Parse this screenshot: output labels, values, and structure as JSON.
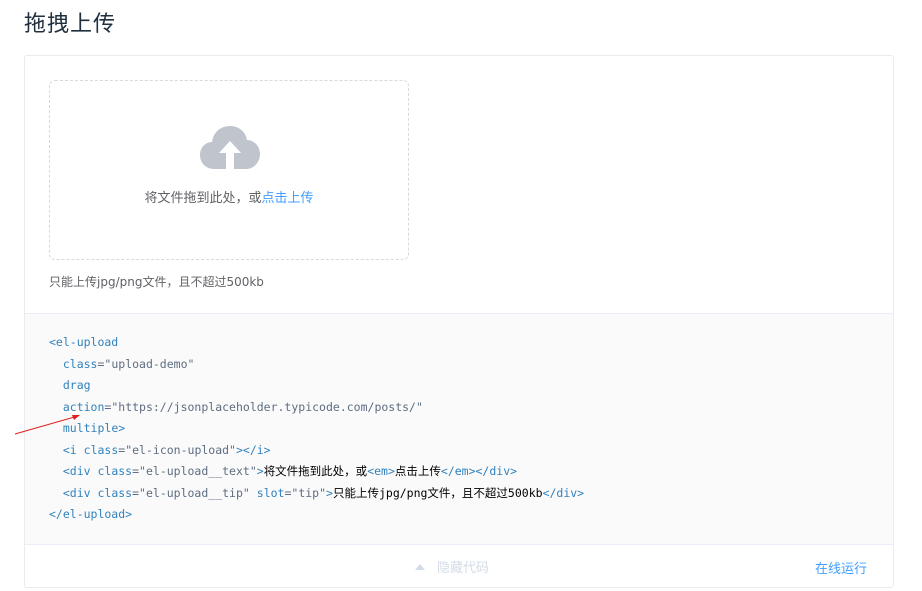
{
  "page": {
    "title": "拖拽上传"
  },
  "upload": {
    "drag_text": "将文件拖到此处，或",
    "click_text": "点击上传",
    "tip": "只能上传jpg/png文件，且不超过500kb"
  },
  "code": {
    "l1_open": "<el-upload",
    "l2_attr": "class",
    "l2_val": "\"upload-demo\"",
    "l3": "drag",
    "l4_attr": "action",
    "l4_val": "\"https://jsonplaceholder.typicode.com/posts/\"",
    "l5": "multiple>",
    "l6_open": "<i ",
    "l6_attr": "class",
    "l6_val": "\"el-icon-upload\"",
    "l6_close": "></i>",
    "l7_open": "<div ",
    "l7_attr": "class",
    "l7_val": "\"el-upload__text\"",
    "l7_gt": ">",
    "l7_text": "将文件拖到此处，或",
    "l7_em_open": "<em>",
    "l7_em_text": "点击上传",
    "l7_close": "</em></div>",
    "l8_open": "<div ",
    "l8_attr1": "class",
    "l8_val1": "\"el-upload__tip\"",
    "l8_attr2": "slot",
    "l8_val2": "\"tip\"",
    "l8_gt": ">",
    "l8_text": "只能上传jpg/png文件，且不超过500kb",
    "l8_close": "</div>",
    "l9": "</el-upload>"
  },
  "control": {
    "toggle_label": "隐藏代码",
    "run_label": "在线运行"
  },
  "colors": {
    "accent": "#409eff",
    "icon": "#c0c4cc",
    "annotation": "#e02020"
  }
}
